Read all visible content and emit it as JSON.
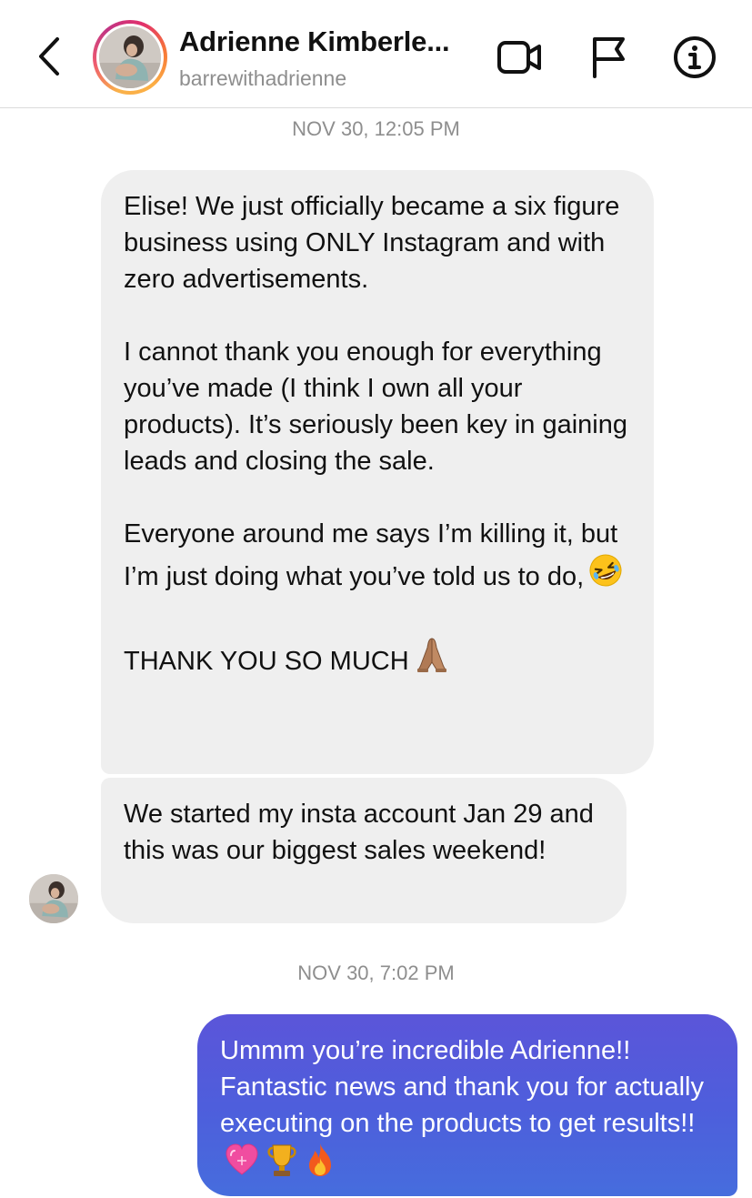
{
  "header": {
    "name": "Adrienne Kimberle...",
    "handle": "barrewithadrienne"
  },
  "icons": {
    "back": "chevron-left-icon",
    "video": "video-camera-icon",
    "flag": "flag-icon",
    "info": "info-icon"
  },
  "messages": {
    "timestamp_1": "NOV 30, 12:05 PM",
    "incoming_1_text": "Elise! We just officially became a six figure business using ONLY Instagram and with zero advertisements.\n\nI cannot thank you enough for everything you’ve made (I think I own all your products). It’s seriously been key in gaining leads and closing the sale.\n\nEveryone around me says I’m killing it, but I’m just doing what you’ve told us to do,",
    "incoming_1_text_2": "\n\nTHANK YOU SO MUCH",
    "incoming_2_text": "We started my insta account Jan 29 and this was our biggest sales weekend!",
    "timestamp_2": "NOV 30, 7:02 PM",
    "outgoing_1_text": "Ummm you’re incredible Adrienne!! Fantastic news and thank you for actually executing on the products to get results!!"
  },
  "colors": {
    "incoming_bubble": "#efefef",
    "outgoing_bubble_top": "#5b55d9",
    "outgoing_bubble_bottom": "#466ddd",
    "timestamp": "#8e8e8e",
    "handle": "#8e8e8e",
    "divider": "#dbdbdb"
  }
}
